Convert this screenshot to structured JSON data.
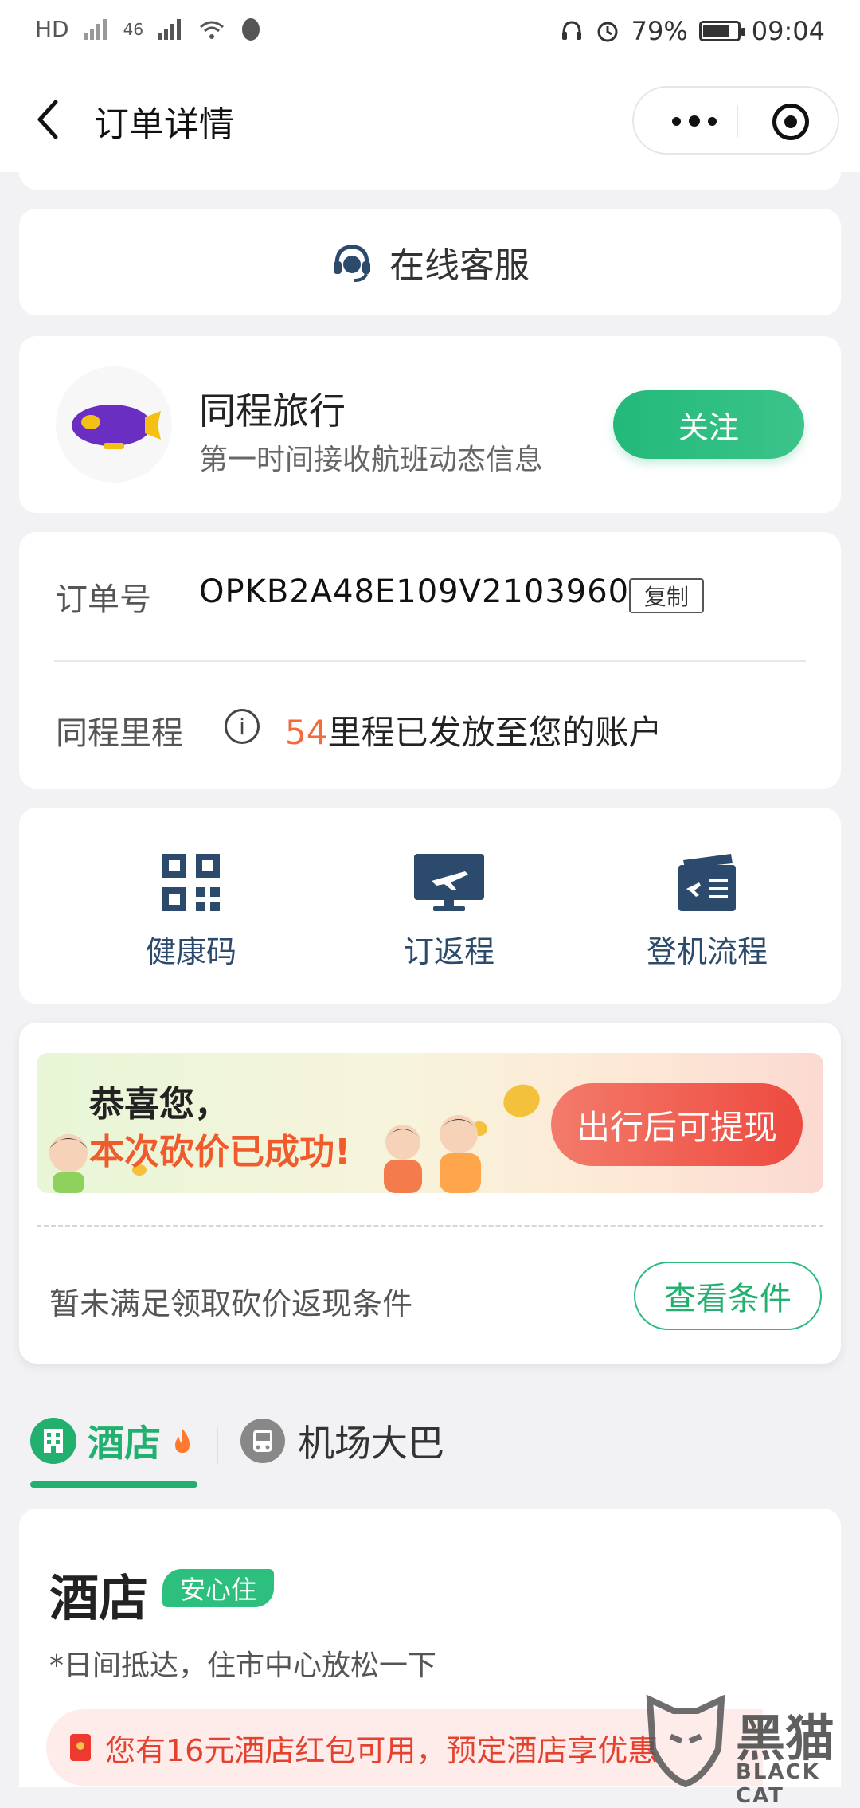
{
  "status_bar": {
    "left_indicators": [
      "HD",
      "46"
    ],
    "battery_percent": "79%",
    "battery_level": 0.79,
    "time": "09:04"
  },
  "nav": {
    "title": "订单详情"
  },
  "service": {
    "label": "在线客服",
    "icon": "headset-icon"
  },
  "follow": {
    "name": "同程旅行",
    "subtitle": "第一时间接收航班动态信息",
    "button": "关注"
  },
  "order": {
    "label": "订单号",
    "number": "OPKB2A48E109V2103960",
    "copy": "复制",
    "miles_label": "同程里程",
    "miles_value": "54",
    "miles_text": "里程已发放至您的账户"
  },
  "quick_actions": [
    {
      "label": "健康码",
      "icon": "qr-code-icon"
    },
    {
      "label": "订返程",
      "icon": "plane-monitor-icon"
    },
    {
      "label": "登机流程",
      "icon": "boarding-pass-icon"
    }
  ],
  "bargain": {
    "line1": "恭喜您，",
    "line2": "本次砍价已成功!",
    "withdraw": "出行后可提现",
    "condition": "暂未满足领取砍价返现条件",
    "view_button": "查看条件"
  },
  "tabs": {
    "hotel": "酒店",
    "bus": "机场大巴"
  },
  "hotel": {
    "title": "酒店",
    "tag": "安心住",
    "subtitle": "*日间抵达，住市中心放松一下",
    "coupon": "您有16元酒店红包可用，预定酒店享优惠"
  },
  "watermark": {
    "text": "黑猫",
    "sub": "BLACK CAT"
  },
  "colors": {
    "accent": "#22b06f",
    "highlight": "#f26b3a",
    "warning": "#e5412f"
  }
}
